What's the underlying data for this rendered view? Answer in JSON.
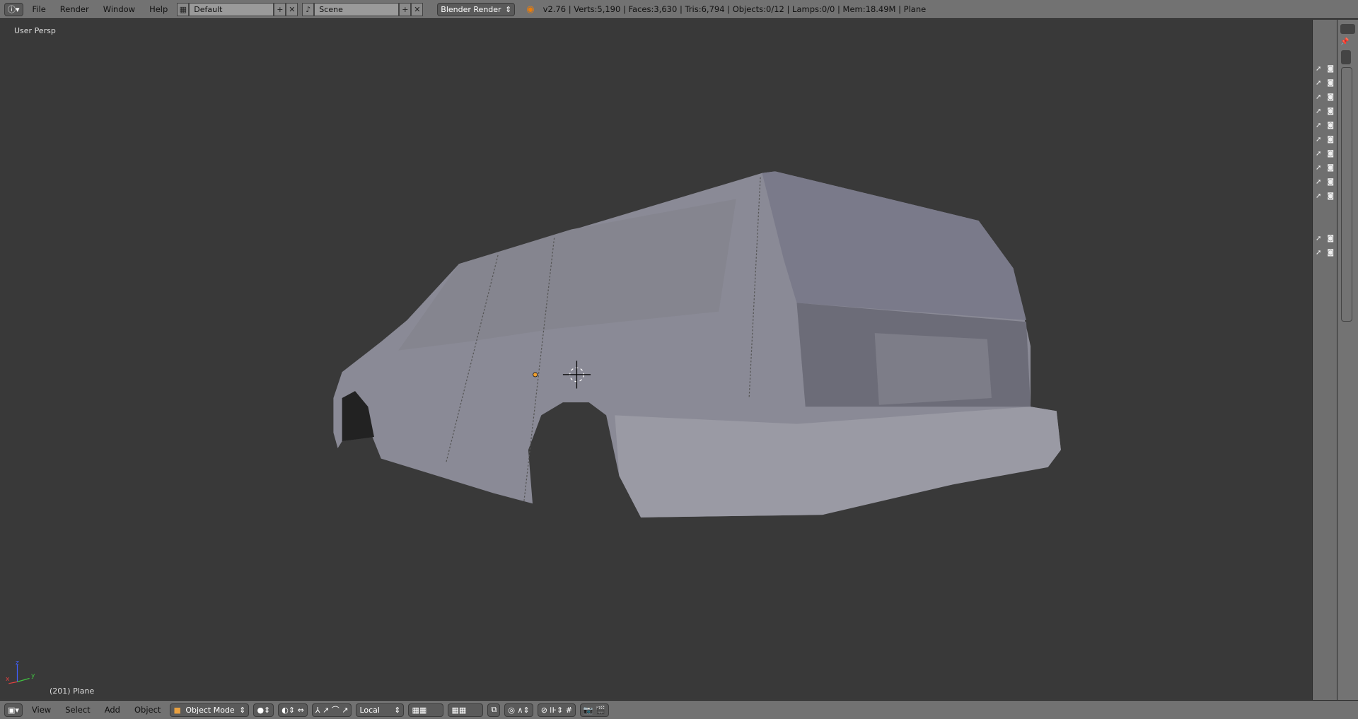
{
  "top_bar": {
    "menus": [
      "File",
      "Render",
      "Window",
      "Help"
    ],
    "layout": "Default",
    "scene": "Scene",
    "engine": "Blender Render",
    "status": "v2.76 | Verts:5,190 | Faces:3,630 | Tris:6,794 | Objects:0/12 | Lamps:0/0 | Mem:18.49M | Plane"
  },
  "viewport": {
    "view_label": "User Persp",
    "object_label": "(201) Plane",
    "axis_labels": [
      "x",
      "y",
      "z"
    ]
  },
  "bottom_bar": {
    "menus": [
      "View",
      "Select",
      "Add",
      "Object"
    ],
    "mode": "Object Mode",
    "orientation": "Local"
  },
  "outliner_rows": 12,
  "colors": {
    "header": "#727272",
    "viewport": "#393939",
    "mesh": "#8a8a96"
  }
}
